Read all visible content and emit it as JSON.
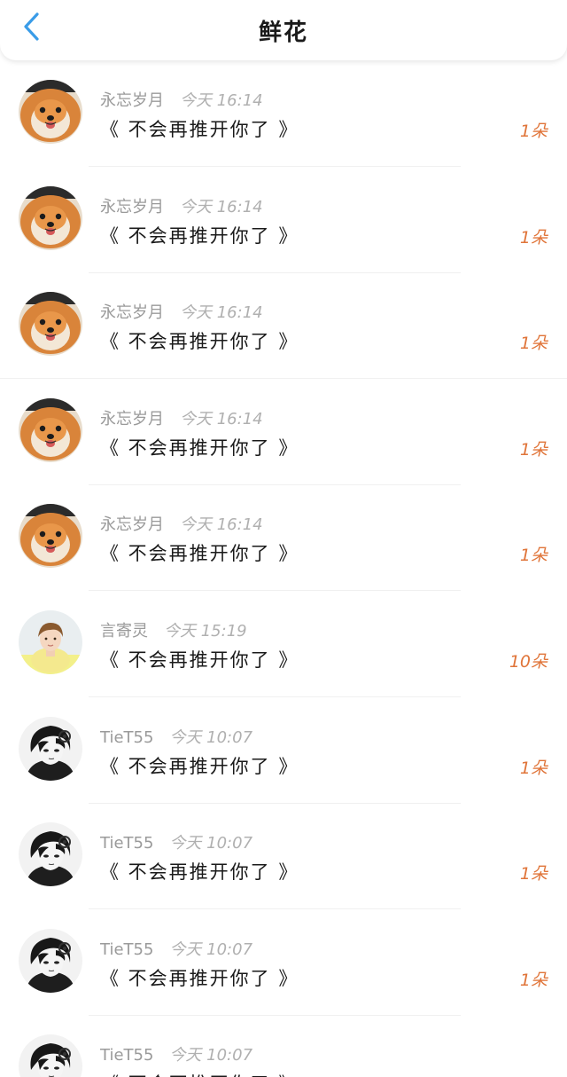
{
  "header": {
    "title": "鲜花",
    "back_icon": "chevron-left-icon",
    "accent_color": "#3a9ce8"
  },
  "list": {
    "items": [
      {
        "name": "永忘岁月",
        "time": "今天 16:14",
        "message": "《 不会再推开你了 》",
        "count": "1朵",
        "avatar": "pomeranian-dog"
      },
      {
        "name": "永忘岁月",
        "time": "今天 16:14",
        "message": "《 不会再推开你了 》",
        "count": "1朵",
        "avatar": "pomeranian-dog"
      },
      {
        "name": "永忘岁月",
        "time": "今天 16:14",
        "message": "《 不会再推开你了 》",
        "count": "1朵",
        "avatar": "pomeranian-dog"
      },
      {
        "name": "永忘岁月",
        "time": "今天 16:14",
        "message": "《 不会再推开你了 》",
        "count": "1朵",
        "avatar": "pomeranian-dog"
      },
      {
        "name": "永忘岁月",
        "time": "今天 16:14",
        "message": "《 不会再推开你了 》",
        "count": "1朵",
        "avatar": "pomeranian-dog"
      },
      {
        "name": "言寄灵",
        "time": "今天 15:19",
        "message": "《 不会再推开你了 》",
        "count": "10朵",
        "avatar": "young-man-photo"
      },
      {
        "name": "TieT55",
        "time": "今天 10:07",
        "message": "《 不会再推开你了 》",
        "count": "1朵",
        "avatar": "anime-boy"
      },
      {
        "name": "TieT55",
        "time": "今天 10:07",
        "message": "《 不会再推开你了 》",
        "count": "1朵",
        "avatar": "anime-boy"
      },
      {
        "name": "TieT55",
        "time": "今天 10:07",
        "message": "《 不会再推开你了 》",
        "count": "1朵",
        "avatar": "anime-boy"
      },
      {
        "name": "TieT55",
        "time": "今天 10:07",
        "message": "《 不会再推开你了 》",
        "count": "",
        "avatar": "anime-boy"
      }
    ]
  },
  "colors": {
    "count": "#e0753a",
    "meta": "#9a9a9a",
    "text": "#1a1a1a"
  }
}
